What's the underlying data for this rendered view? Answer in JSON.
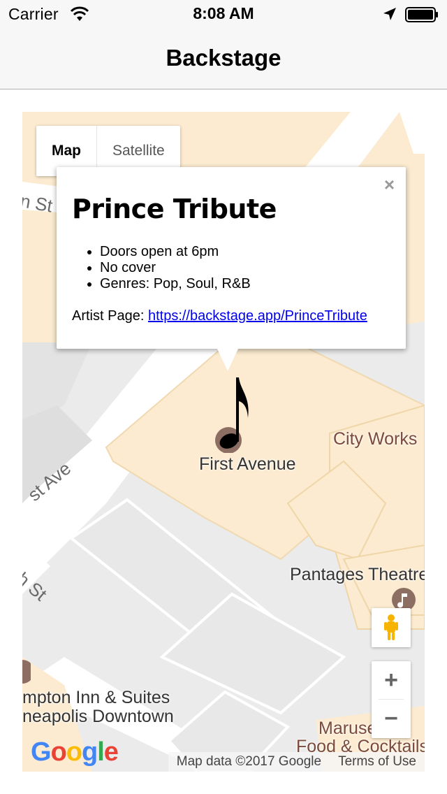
{
  "status_bar": {
    "carrier": "Carrier",
    "time": "8:08 AM"
  },
  "nav": {
    "title": "Backstage"
  },
  "map": {
    "type_control": {
      "map_label": "Map",
      "satellite_label": "Satellite"
    },
    "info_window": {
      "title": "Prince Tribute",
      "details": [
        "Doors open at 6pm",
        "No cover",
        "Genres: Pop, Soul, R&B"
      ],
      "artist_page_label": "Artist Page:",
      "artist_page_url": "https://backstage.app/PrinceTribute",
      "close_label": "×"
    },
    "marker_label": "First Avenue",
    "labels": {
      "city_works": "City Works",
      "pantages": "Pantages Theatre",
      "hampton_line1": "mpton Inn & Suites",
      "hampton_line2": "neapolis Downtown",
      "maruso_line1": "Maruse",
      "maruso_line2": "Food & Cocktails"
    },
    "streets": {
      "st_top": "n St",
      "first_ave": "st Ave",
      "sixth_st": "th St"
    },
    "zoom_in": "+",
    "zoom_out": "−",
    "logo": "Google",
    "attribution": "Map data ©2017 Google",
    "terms": "Terms of Use",
    "colors": {
      "building": "#fcebd0",
      "road": "#ffffff",
      "block": "#e8e8e8",
      "link": "#0000ee"
    }
  }
}
